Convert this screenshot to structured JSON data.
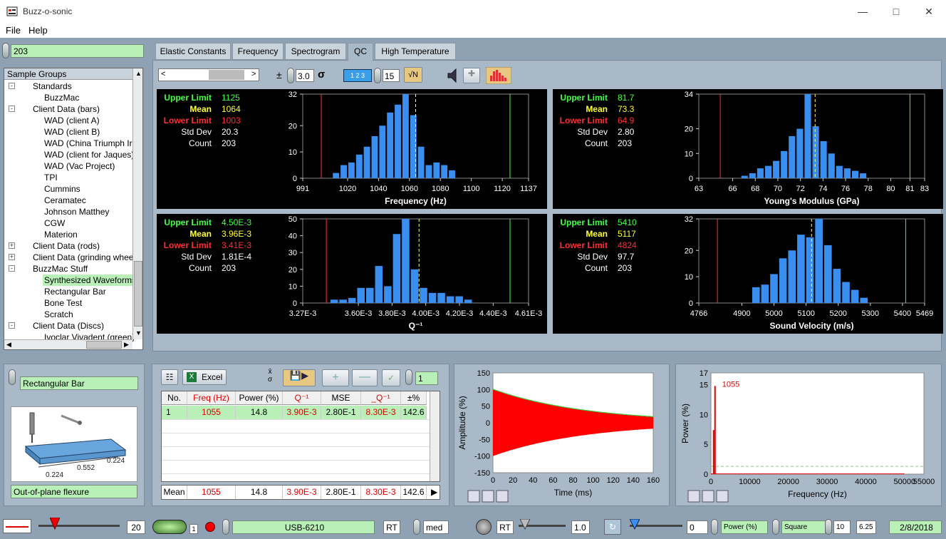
{
  "window": {
    "title": "Buzz-o-sonic",
    "controls": [
      "minimize-icon",
      "maximize-icon",
      "close-icon"
    ]
  },
  "menu": [
    "File",
    "Help"
  ],
  "sample_count_field": "203",
  "tree": {
    "header": "Sample Groups",
    "rows": [
      {
        "label": "Standards",
        "level": 1,
        "exp": "-"
      },
      {
        "label": "BuzzMac",
        "level": 2
      },
      {
        "label": "Client Data (bars)",
        "level": 1,
        "exp": "-"
      },
      {
        "label": "WAD (client A)",
        "level": 2
      },
      {
        "label": "WAD (client B)",
        "level": 2
      },
      {
        "label": "WAD (China Triumph Ir",
        "level": 2
      },
      {
        "label": "WAD (client for Jaques)",
        "level": 2
      },
      {
        "label": "WAD (Vac Project)",
        "level": 2
      },
      {
        "label": "TPI",
        "level": 2
      },
      {
        "label": "Cummins",
        "level": 2
      },
      {
        "label": "Ceramatec",
        "level": 2
      },
      {
        "label": "Johnson Matthey",
        "level": 2
      },
      {
        "label": "CGW",
        "level": 2
      },
      {
        "label": "Materion",
        "level": 2
      },
      {
        "label": "Client Data (rods)",
        "level": 1,
        "exp": "+"
      },
      {
        "label": "Client Data (grinding whee",
        "level": 1,
        "exp": "+"
      },
      {
        "label": "BuzzMac Stuff",
        "level": 1,
        "exp": "-"
      },
      {
        "label": "Synthesized Waveforms",
        "level": 2,
        "selected": true
      },
      {
        "label": "Rectangular Bar",
        "level": 2
      },
      {
        "label": "Bone Test",
        "level": 2
      },
      {
        "label": "Scratch",
        "level": 2
      },
      {
        "label": "Client Data (Discs)",
        "level": 1,
        "exp": "-"
      },
      {
        "label": "Ivoclar Vivadent (green)",
        "level": 2
      }
    ]
  },
  "tabs": [
    "Elastic Constants",
    "Frequency",
    "Spectrogram",
    "QC",
    "High Temperature"
  ],
  "active_tab": "QC",
  "toolbar": {
    "sigma_value": "3.0",
    "sigma_symbol": "σ",
    "pm": "±",
    "bins_value": "15",
    "sqrtn": "√N",
    "bins_icon": "1 2 3"
  },
  "stat_labels": {
    "upper": "Upper Limit",
    "mean": "Mean",
    "lower": "Lower Limit",
    "std": "Std Dev",
    "count": "Count"
  },
  "histograms": [
    {
      "stats": {
        "upper": "1125",
        "mean": "1064",
        "lower": "1003",
        "std": "20.3",
        "count": "203"
      },
      "chart_data": {
        "type": "bar",
        "xlabel": "Frequency (Hz)",
        "xlim": [
          991,
          1137
        ],
        "ylim": [
          0,
          32
        ],
        "yticks": [
          "0",
          "10",
          "20",
          "32"
        ],
        "xticks": [
          "991",
          "1020",
          "1040",
          "1060",
          "1080",
          "1100",
          "1120",
          "1137"
        ],
        "xtick_vals": [
          991,
          1020,
          1040,
          1060,
          1080,
          1100,
          1120,
          1137
        ],
        "bin_start": 1010,
        "bin_width": 5,
        "values": [
          2,
          5,
          6,
          9,
          12,
          16,
          20,
          25,
          28,
          32,
          24,
          12,
          5,
          6,
          5,
          3
        ],
        "lower": 1003,
        "mean": 1064,
        "upper": 1125
      }
    },
    {
      "stats": {
        "upper": "81.7",
        "mean": "73.3",
        "lower": "64.9",
        "std": "2.80",
        "count": "203"
      },
      "chart_data": {
        "type": "bar",
        "xlabel": "Young's Modulus (GPa)",
        "xlim": [
          63,
          83
        ],
        "ylim": [
          0,
          34
        ],
        "yticks": [
          "0",
          "10",
          "20",
          "34"
        ],
        "xticks": [
          "63",
          "66",
          "68",
          "70",
          "72",
          "74",
          "76",
          "78",
          "80",
          "81",
          "83"
        ],
        "xtick_vals": [
          63,
          66,
          68,
          70,
          72,
          74,
          76,
          78,
          80,
          81.7,
          83
        ],
        "bin_start": 66.7,
        "bin_width": 0.7,
        "values": [
          1,
          2,
          4,
          5,
          7,
          11,
          17,
          20,
          34,
          21,
          15,
          10,
          5,
          4,
          3,
          2
        ],
        "lower": 64.9,
        "mean": 73.3,
        "upper": 81.7
      }
    },
    {
      "stats": {
        "upper": "4.50E-3",
        "mean": "3.96E-3",
        "lower": "3.41E-3",
        "std": "1.81E-4",
        "count": "203"
      },
      "chart_data": {
        "type": "bar",
        "xlabel": "Q⁻¹",
        "xlim": [
          3.27,
          4.61
        ],
        "ylim": [
          0,
          50
        ],
        "yticks": [
          "0",
          "10",
          "20",
          "30",
          "40",
          "50"
        ],
        "xticks": [
          "3.27E-3",
          "3.60E-3",
          "3.80E-3",
          "4.00E-3",
          "4.20E-3",
          "4.40E-3",
          "4.61E-3"
        ],
        "xtick_vals": [
          3.27,
          3.6,
          3.8,
          4.0,
          4.2,
          4.4,
          4.61
        ],
        "bin_start": 3.43,
        "bin_width": 0.053,
        "values": [
          2,
          2,
          3,
          9,
          9,
          22,
          10,
          41,
          50,
          20,
          9,
          6,
          6,
          4,
          4,
          2
        ],
        "lower": 3.41,
        "mean": 3.96,
        "upper": 4.5
      }
    },
    {
      "stats": {
        "upper": "5410",
        "mean": "5117",
        "lower": "4824",
        "std": "97.7",
        "count": "203"
      },
      "chart_data": {
        "type": "bar",
        "xlabel": "Sound Velocity (m/s)",
        "xlim": [
          4766,
          5469
        ],
        "ylim": [
          0,
          32
        ],
        "yticks": [
          "0",
          "10",
          "20",
          "32"
        ],
        "xticks": [
          "4766",
          "4900",
          "5000",
          "5100",
          "5200",
          "5300",
          "5400",
          "5469"
        ],
        "xtick_vals": [
          4766,
          4900,
          5000,
          5100,
          5200,
          5300,
          5400,
          5469
        ],
        "bin_start": 4930,
        "bin_width": 28,
        "values": [
          6,
          7,
          11,
          17,
          20,
          26,
          25,
          32,
          22,
          13,
          8,
          5,
          2
        ],
        "lower": 4824,
        "mean": 5117,
        "upper": 5410
      }
    }
  ],
  "sample": {
    "name": "Rectangular Bar",
    "mode": "Out-of-plane flexure",
    "dims": [
      "0.224",
      "0.552",
      "0.224"
    ]
  },
  "table": {
    "excel_label": "Excel",
    "count_value": "1",
    "xs_label": "x̄\nσ",
    "columns": [
      "No.",
      "Freq (Hz)",
      "Power (%)",
      "Q⁻¹",
      "MSE",
      "_Q⁻¹",
      "±%"
    ],
    "rows": [
      [
        "1",
        "1055",
        "14.8",
        "3.90E-3",
        "2.80E-1",
        "8.30E-3",
        "142.6"
      ]
    ],
    "mean": [
      "Mean",
      "1055",
      "14.8",
      "3.90E-3",
      "2.80E-1",
      "8.30E-3",
      "142.6"
    ]
  },
  "waveform": {
    "chart_data": {
      "type": "line",
      "xlabel": "Time (ms)",
      "ylabel": "Amplitude (%)",
      "xlim": [
        0,
        160
      ],
      "ylim": [
        -150,
        150
      ],
      "xticks": [
        "0",
        "20",
        "40",
        "60",
        "80",
        "100",
        "120",
        "140",
        "160"
      ],
      "yticks": [
        "150",
        "100",
        "50",
        "0",
        "-50",
        "-100",
        "-150"
      ],
      "envelope_start": 100,
      "envelope_end": 15
    }
  },
  "spectrum": {
    "chart_data": {
      "type": "line",
      "xlabel": "Frequency (Hz)",
      "ylabel": "Power (%)",
      "xlim": [
        0,
        55000
      ],
      "ylim": [
        0,
        17
      ],
      "xticks": [
        "0",
        "10000",
        "20000",
        "30000",
        "40000",
        "50000",
        "55000"
      ],
      "yticks": [
        "17",
        "15",
        "10",
        "5",
        "0"
      ],
      "peak_label": "1055",
      "peak_x": 1055,
      "peak_y": 14.8
    }
  },
  "status": {
    "device": "USB-6210",
    "rt1": "RT",
    "med": "med",
    "rt2": "RT",
    "gain": "1.0",
    "power_val": "0",
    "power_label": "Power (%)",
    "window": "Square",
    "n": "10",
    "val": "6.25",
    "date": "2/8/2018",
    "slider_val": "20",
    "small_val": "1"
  },
  "colors": {
    "bar": "#3a8ef0",
    "green": "#44ff44",
    "yellow": "#ffff33",
    "red": "#ff3030",
    "wave": "#ff0000"
  }
}
